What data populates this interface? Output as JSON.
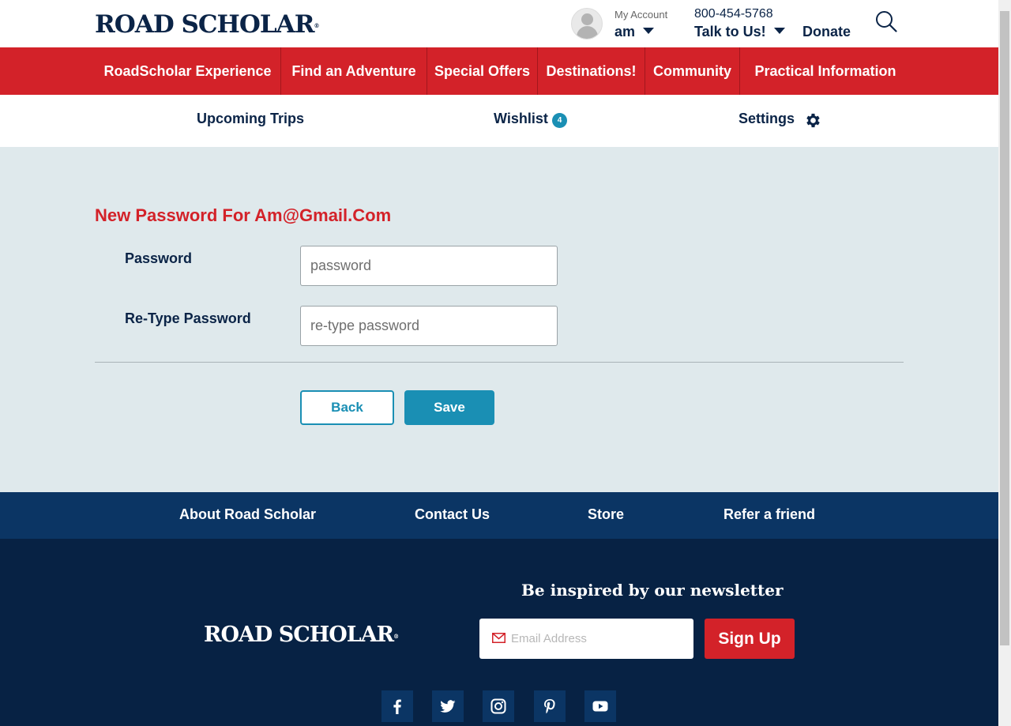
{
  "header": {
    "logo": "ROAD SCHOLAR",
    "logo_mark": "®",
    "account_label": "My Account",
    "account_user": "am",
    "phone": "800-454-5768",
    "talk": "Talk to Us!",
    "donate": "Donate"
  },
  "nav": {
    "items": [
      {
        "label": "RoadScholar Experience"
      },
      {
        "label": "Find an Adventure"
      },
      {
        "label": "Special Offers"
      },
      {
        "label": "Destinations!"
      },
      {
        "label": "Community"
      },
      {
        "label": "Practical Information"
      }
    ]
  },
  "subnav": {
    "upcoming": "Upcoming Trips",
    "wishlist": "Wishlist",
    "wishlist_count": "4",
    "settings": "Settings"
  },
  "form": {
    "title": "New Password For Am@Gmail.Com",
    "password_label": "Password",
    "password_placeholder": "password",
    "retype_label": "Re-Type Password",
    "retype_placeholder": "re-type password",
    "back": "Back",
    "save": "Save"
  },
  "footer": {
    "links": [
      {
        "label": "About Road Scholar"
      },
      {
        "label": "Contact Us"
      },
      {
        "label": "Store"
      },
      {
        "label": "Refer a friend"
      }
    ],
    "logo": "ROAD SCHOLAR",
    "logo_mark": "®",
    "newsletter_title": "Be inspired by our newsletter",
    "email_placeholder": "Email Address",
    "signup": "Sign Up",
    "social": [
      "facebook-icon",
      "twitter-icon",
      "instagram-icon",
      "pinterest-icon",
      "youtube-icon"
    ]
  },
  "colors": {
    "brand_red": "#d32229",
    "navy": "#0b2447",
    "accent_blue": "#1a8fb4",
    "page_bg": "#dfe9ec"
  }
}
